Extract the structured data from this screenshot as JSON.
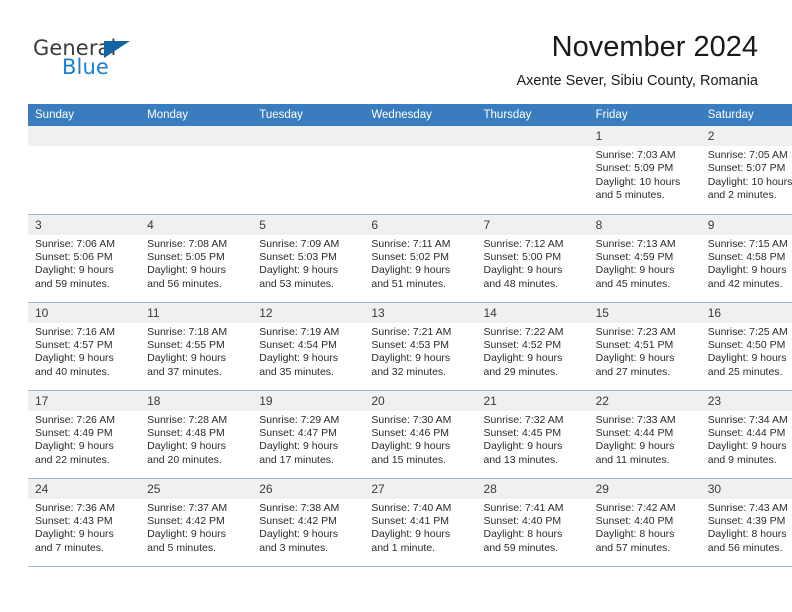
{
  "brand": {
    "name_top": "General",
    "name_bottom": "Blue",
    "colors": {
      "triangle": "#1464a5",
      "blue_text": "#1b7fd4",
      "header_blue": "#3a7dbf",
      "daynum_band": "#f0f0f0"
    }
  },
  "header": {
    "title": "November 2024",
    "subtitle": "Axente Sever, Sibiu County, Romania"
  },
  "calendar": {
    "weekday_headers": [
      "Sunday",
      "Monday",
      "Tuesday",
      "Wednesday",
      "Thursday",
      "Friday",
      "Saturday"
    ],
    "weeks": [
      [
        {
          "day": "",
          "empty": true
        },
        {
          "day": "",
          "empty": true
        },
        {
          "day": "",
          "empty": true
        },
        {
          "day": "",
          "empty": true
        },
        {
          "day": "",
          "empty": true
        },
        {
          "day": "1",
          "sunrise": "Sunrise: 7:03 AM",
          "sunset": "Sunset: 5:09 PM",
          "daylight_line1": "Daylight: 10 hours",
          "daylight_line2": "and 5 minutes."
        },
        {
          "day": "2",
          "sunrise": "Sunrise: 7:05 AM",
          "sunset": "Sunset: 5:07 PM",
          "daylight_line1": "Daylight: 10 hours",
          "daylight_line2": "and 2 minutes."
        }
      ],
      [
        {
          "day": "3",
          "sunrise": "Sunrise: 7:06 AM",
          "sunset": "Sunset: 5:06 PM",
          "daylight_line1": "Daylight: 9 hours",
          "daylight_line2": "and 59 minutes."
        },
        {
          "day": "4",
          "sunrise": "Sunrise: 7:08 AM",
          "sunset": "Sunset: 5:05 PM",
          "daylight_line1": "Daylight: 9 hours",
          "daylight_line2": "and 56 minutes."
        },
        {
          "day": "5",
          "sunrise": "Sunrise: 7:09 AM",
          "sunset": "Sunset: 5:03 PM",
          "daylight_line1": "Daylight: 9 hours",
          "daylight_line2": "and 53 minutes."
        },
        {
          "day": "6",
          "sunrise": "Sunrise: 7:11 AM",
          "sunset": "Sunset: 5:02 PM",
          "daylight_line1": "Daylight: 9 hours",
          "daylight_line2": "and 51 minutes."
        },
        {
          "day": "7",
          "sunrise": "Sunrise: 7:12 AM",
          "sunset": "Sunset: 5:00 PM",
          "daylight_line1": "Daylight: 9 hours",
          "daylight_line2": "and 48 minutes."
        },
        {
          "day": "8",
          "sunrise": "Sunrise: 7:13 AM",
          "sunset": "Sunset: 4:59 PM",
          "daylight_line1": "Daylight: 9 hours",
          "daylight_line2": "and 45 minutes."
        },
        {
          "day": "9",
          "sunrise": "Sunrise: 7:15 AM",
          "sunset": "Sunset: 4:58 PM",
          "daylight_line1": "Daylight: 9 hours",
          "daylight_line2": "and 42 minutes."
        }
      ],
      [
        {
          "day": "10",
          "sunrise": "Sunrise: 7:16 AM",
          "sunset": "Sunset: 4:57 PM",
          "daylight_line1": "Daylight: 9 hours",
          "daylight_line2": "and 40 minutes."
        },
        {
          "day": "11",
          "sunrise": "Sunrise: 7:18 AM",
          "sunset": "Sunset: 4:55 PM",
          "daylight_line1": "Daylight: 9 hours",
          "daylight_line2": "and 37 minutes."
        },
        {
          "day": "12",
          "sunrise": "Sunrise: 7:19 AM",
          "sunset": "Sunset: 4:54 PM",
          "daylight_line1": "Daylight: 9 hours",
          "daylight_line2": "and 35 minutes."
        },
        {
          "day": "13",
          "sunrise": "Sunrise: 7:21 AM",
          "sunset": "Sunset: 4:53 PM",
          "daylight_line1": "Daylight: 9 hours",
          "daylight_line2": "and 32 minutes."
        },
        {
          "day": "14",
          "sunrise": "Sunrise: 7:22 AM",
          "sunset": "Sunset: 4:52 PM",
          "daylight_line1": "Daylight: 9 hours",
          "daylight_line2": "and 29 minutes."
        },
        {
          "day": "15",
          "sunrise": "Sunrise: 7:23 AM",
          "sunset": "Sunset: 4:51 PM",
          "daylight_line1": "Daylight: 9 hours",
          "daylight_line2": "and 27 minutes."
        },
        {
          "day": "16",
          "sunrise": "Sunrise: 7:25 AM",
          "sunset": "Sunset: 4:50 PM",
          "daylight_line1": "Daylight: 9 hours",
          "daylight_line2": "and 25 minutes."
        }
      ],
      [
        {
          "day": "17",
          "sunrise": "Sunrise: 7:26 AM",
          "sunset": "Sunset: 4:49 PM",
          "daylight_line1": "Daylight: 9 hours",
          "daylight_line2": "and 22 minutes."
        },
        {
          "day": "18",
          "sunrise": "Sunrise: 7:28 AM",
          "sunset": "Sunset: 4:48 PM",
          "daylight_line1": "Daylight: 9 hours",
          "daylight_line2": "and 20 minutes."
        },
        {
          "day": "19",
          "sunrise": "Sunrise: 7:29 AM",
          "sunset": "Sunset: 4:47 PM",
          "daylight_line1": "Daylight: 9 hours",
          "daylight_line2": "and 17 minutes."
        },
        {
          "day": "20",
          "sunrise": "Sunrise: 7:30 AM",
          "sunset": "Sunset: 4:46 PM",
          "daylight_line1": "Daylight: 9 hours",
          "daylight_line2": "and 15 minutes."
        },
        {
          "day": "21",
          "sunrise": "Sunrise: 7:32 AM",
          "sunset": "Sunset: 4:45 PM",
          "daylight_line1": "Daylight: 9 hours",
          "daylight_line2": "and 13 minutes."
        },
        {
          "day": "22",
          "sunrise": "Sunrise: 7:33 AM",
          "sunset": "Sunset: 4:44 PM",
          "daylight_line1": "Daylight: 9 hours",
          "daylight_line2": "and 11 minutes."
        },
        {
          "day": "23",
          "sunrise": "Sunrise: 7:34 AM",
          "sunset": "Sunset: 4:44 PM",
          "daylight_line1": "Daylight: 9 hours",
          "daylight_line2": "and 9 minutes."
        }
      ],
      [
        {
          "day": "24",
          "sunrise": "Sunrise: 7:36 AM",
          "sunset": "Sunset: 4:43 PM",
          "daylight_line1": "Daylight: 9 hours",
          "daylight_line2": "and 7 minutes."
        },
        {
          "day": "25",
          "sunrise": "Sunrise: 7:37 AM",
          "sunset": "Sunset: 4:42 PM",
          "daylight_line1": "Daylight: 9 hours",
          "daylight_line2": "and 5 minutes."
        },
        {
          "day": "26",
          "sunrise": "Sunrise: 7:38 AM",
          "sunset": "Sunset: 4:42 PM",
          "daylight_line1": "Daylight: 9 hours",
          "daylight_line2": "and 3 minutes."
        },
        {
          "day": "27",
          "sunrise": "Sunrise: 7:40 AM",
          "sunset": "Sunset: 4:41 PM",
          "daylight_line1": "Daylight: 9 hours",
          "daylight_line2": "and 1 minute."
        },
        {
          "day": "28",
          "sunrise": "Sunrise: 7:41 AM",
          "sunset": "Sunset: 4:40 PM",
          "daylight_line1": "Daylight: 8 hours",
          "daylight_line2": "and 59 minutes."
        },
        {
          "day": "29",
          "sunrise": "Sunrise: 7:42 AM",
          "sunset": "Sunset: 4:40 PM",
          "daylight_line1": "Daylight: 8 hours",
          "daylight_line2": "and 57 minutes."
        },
        {
          "day": "30",
          "sunrise": "Sunrise: 7:43 AM",
          "sunset": "Sunset: 4:39 PM",
          "daylight_line1": "Daylight: 8 hours",
          "daylight_line2": "and 56 minutes."
        }
      ]
    ]
  }
}
